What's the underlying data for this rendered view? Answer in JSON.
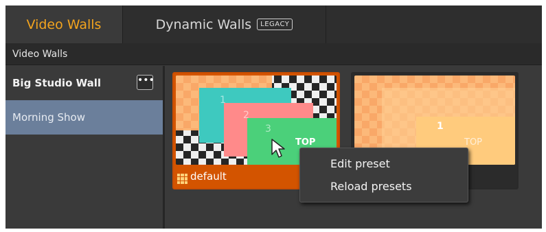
{
  "tabs": [
    {
      "label": "Video Walls",
      "active": true
    },
    {
      "label": "Dynamic Walls",
      "badge": "LEGACY",
      "active": false
    }
  ],
  "section_label": "Video Walls",
  "sidebar": {
    "wall_name": "Big Studio Wall",
    "more_button": "•••",
    "shows": [
      {
        "label": "Morning Show",
        "selected": true
      }
    ]
  },
  "presets": [
    {
      "name": "default",
      "selected": true,
      "layers": [
        {
          "number": "1",
          "color": "#3ec9bf"
        },
        {
          "number": "2",
          "color": "#ff8a8a"
        },
        {
          "number": "3",
          "color": "#4bd07a"
        }
      ],
      "top_label": "TOP"
    },
    {
      "name": "",
      "selected": false,
      "layers": [
        {
          "number": "1",
          "color": "#ffcb7d"
        }
      ],
      "top_label": "TOP"
    }
  ],
  "context_menu": {
    "items": [
      "Edit preset",
      "Reload presets"
    ]
  },
  "colors": {
    "accent": "#f3a41e",
    "selected_preset": "#d35400",
    "selected_show": "#6b7f9b",
    "background": "#3a3a3a"
  },
  "icons": {
    "more": "more-horizontal-icon",
    "preset": "grid-icon",
    "cursor": "mouse-pointer-icon"
  }
}
